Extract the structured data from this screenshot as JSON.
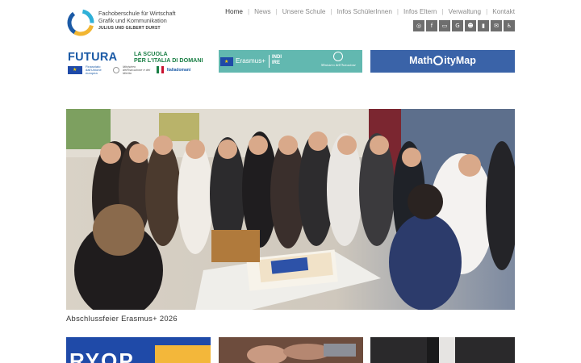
{
  "header": {
    "logo": {
      "line1": "Fachoberschule für Wirtschaft",
      "line2": "Grafik und Kommunikation",
      "line3": "JULIUS UND GILBERT DURST"
    },
    "nav": [
      {
        "label": "Home",
        "active": true
      },
      {
        "label": "News",
        "active": false
      },
      {
        "label": "Unsere Schule",
        "active": false
      },
      {
        "label": "Infos SchülerInnen",
        "active": false
      },
      {
        "label": "Infos Eltern",
        "active": false
      },
      {
        "label": "Verwaltung",
        "active": false
      },
      {
        "label": "Kontakt",
        "active": false
      }
    ],
    "social_icons": [
      "instagram-icon",
      "facebook-icon",
      "monitor-icon",
      "google-icon",
      "users-icon",
      "book-icon",
      "chat-icon",
      "accessibility-icon"
    ]
  },
  "banners": {
    "futura": {
      "title": "FUTURA",
      "right_line1": "LA SCUOLA",
      "right_line2": "PER L'ITALIA DI DOMANI",
      "eu_text": "Finanziato dall'Unione europea",
      "ministry_text": "Ministero dell'Istruzione e del Merito",
      "italia_text": "Italiadomani"
    },
    "erasmus": {
      "label": "Erasmus+",
      "indire": "INDI\nIRE",
      "ministry": "Ministero dell'Istruzione"
    },
    "math": {
      "label_before": "Math",
      "label_after": "ityMap"
    }
  },
  "hero": {
    "caption": "Abschlussfeier Erasmus+ 2026"
  },
  "cards": {
    "card1_text": "RYOP"
  },
  "colors": {
    "nav_text": "#8a8a8a",
    "nav_active": "#333333",
    "social_bg": "#6e6e6e",
    "futura_blue": "#1b5aa6",
    "futura_green": "#1a7f45",
    "erasmus_teal": "#62b8b0",
    "math_blue": "#3a63a8"
  }
}
